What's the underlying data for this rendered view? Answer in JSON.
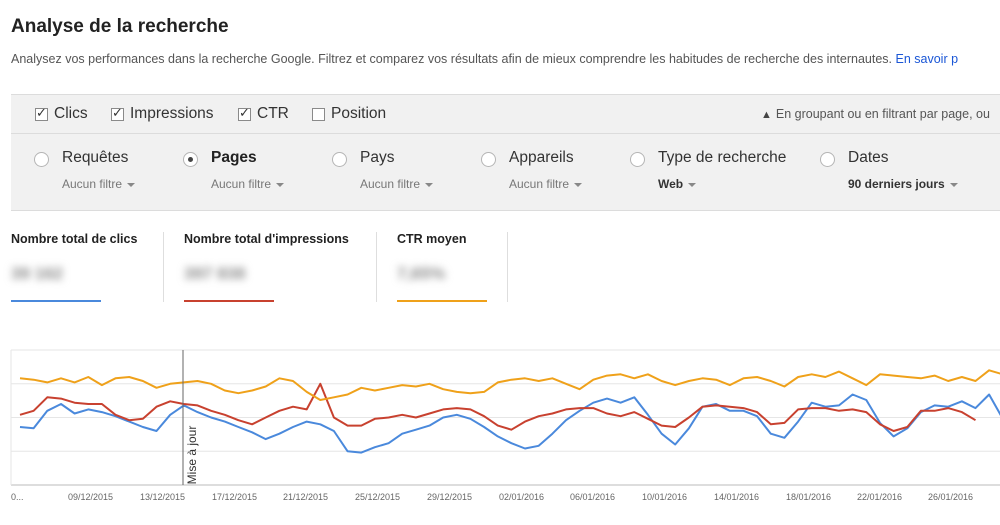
{
  "header": {
    "title": "Analyse de la recherche",
    "subtitle": "Analysez vos performances dans la recherche Google. Filtrez et comparez vos résultats afin de mieux comprendre les habitudes de recherche des internautes.",
    "learn_more": "En savoir p"
  },
  "metrics": {
    "clicks": {
      "label": "Clics",
      "checked": true
    },
    "impressions": {
      "label": "Impressions",
      "checked": true
    },
    "ctr": {
      "label": "CTR",
      "checked": true
    },
    "position": {
      "label": "Position",
      "checked": false
    },
    "notice": "En groupant ou en filtrant par page, ou"
  },
  "dimensions": [
    {
      "label": "Requêtes",
      "filter": "Aucun filtre",
      "selected": false
    },
    {
      "label": "Pages",
      "filter": "Aucun filtre",
      "selected": true
    },
    {
      "label": "Pays",
      "filter": "Aucun filtre",
      "selected": false
    },
    {
      "label": "Appareils",
      "filter": "Aucun filtre",
      "selected": false
    },
    {
      "label": "Type de recherche",
      "filter": "Web",
      "selected": false
    },
    {
      "label": "Dates",
      "filter": "90 derniers jours",
      "selected": false
    }
  ],
  "totals": {
    "clicks": {
      "label": "Nombre total de clics",
      "value": "39 162"
    },
    "impressions": {
      "label": "Nombre total d'impressions",
      "value": "397 838"
    },
    "ctr": {
      "label": "CTR moyen",
      "value": "7,65%"
    }
  },
  "colors": {
    "clicks": "#4a89dc",
    "impressions": "#c8412f",
    "ctr": "#efa11a"
  },
  "chart_data": {
    "type": "line",
    "annotation": "Mise à jour",
    "x_tick_labels": [
      "0...",
      "09/12/2015",
      "13/12/2015",
      "17/12/2015",
      "21/12/2015",
      "25/12/2015",
      "29/12/2015",
      "02/01/2016",
      "06/01/2016",
      "10/01/2016",
      "14/01/2016",
      "18/01/2016",
      "22/01/2016",
      "26/01/2016"
    ],
    "series": [
      {
        "name": "clics",
        "color_key": "clicks",
        "values": [
          43,
          42,
          55,
          60,
          53,
          56,
          54,
          51,
          47,
          43,
          40,
          52,
          59,
          54,
          50,
          47,
          43,
          39,
          34,
          38,
          43,
          47,
          45,
          40,
          25,
          24,
          28,
          31,
          38,
          41,
          44,
          50,
          52,
          49,
          43,
          36,
          31,
          27,
          29,
          38,
          48,
          55,
          61,
          64,
          61,
          65,
          52,
          38,
          30,
          42,
          58,
          60,
          55,
          55,
          51,
          38,
          35,
          47,
          61,
          58,
          59,
          67,
          63,
          46,
          36,
          42,
          54,
          59,
          58,
          62,
          57,
          67,
          49
        ]
      },
      {
        "name": "impressions",
        "color_key": "impressions",
        "values": [
          52,
          55,
          65,
          64,
          61,
          60,
          60,
          52,
          48,
          49,
          58,
          62,
          60,
          59,
          55,
          52,
          48,
          45,
          50,
          55,
          58,
          56,
          75,
          50,
          44,
          44,
          49,
          50,
          52,
          50,
          53,
          56,
          57,
          56,
          51,
          44,
          41,
          47,
          51,
          53,
          56,
          57,
          57,
          53,
          51,
          54,
          49,
          44,
          43,
          50,
          58,
          59,
          58,
          57,
          54,
          45,
          46,
          56,
          57,
          57,
          55,
          56,
          54,
          45,
          40,
          43,
          55,
          55,
          57,
          54,
          48
        ]
      },
      {
        "name": "ctr",
        "color_key": "ctr",
        "values": [
          79,
          78,
          76,
          79,
          76,
          80,
          74,
          79,
          80,
          77,
          72,
          75,
          76,
          77,
          75,
          70,
          68,
          70,
          73,
          79,
          77,
          69,
          63,
          65,
          67,
          72,
          70,
          72,
          74,
          73,
          75,
          71,
          69,
          68,
          69,
          76,
          78,
          79,
          77,
          79,
          75,
          71,
          78,
          81,
          82,
          79,
          82,
          77,
          74,
          77,
          79,
          78,
          74,
          79,
          80,
          77,
          73,
          80,
          82,
          80,
          84,
          79,
          74,
          82,
          81,
          80,
          79,
          81,
          77,
          80,
          77,
          85,
          82
        ]
      }
    ]
  }
}
